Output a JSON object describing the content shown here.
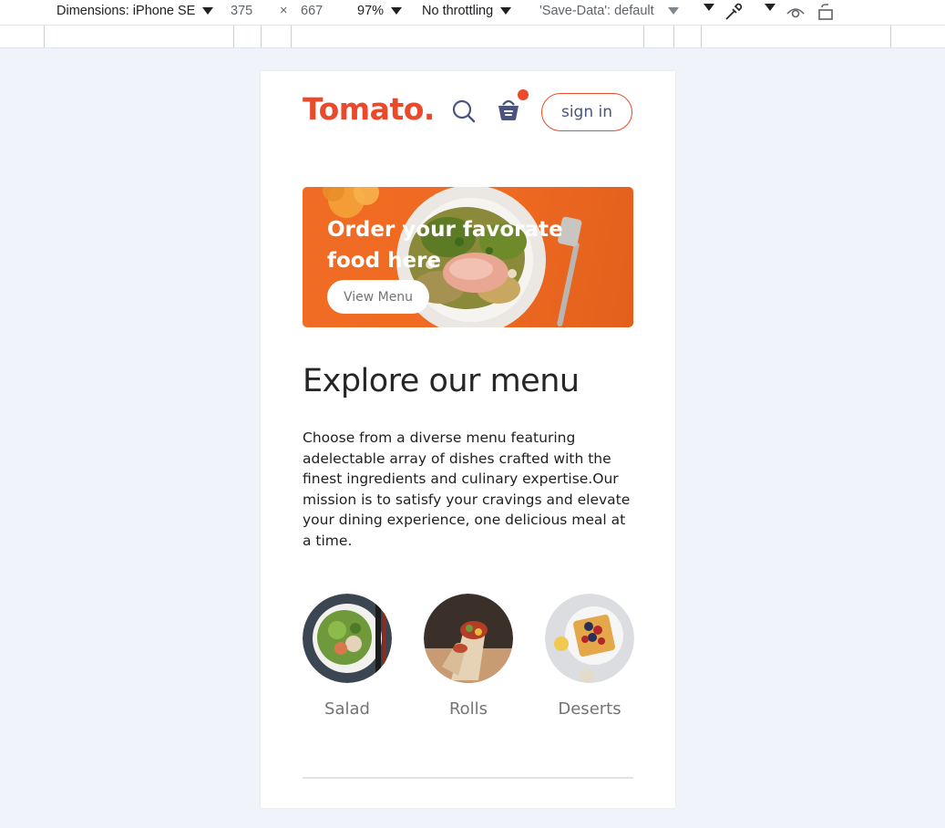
{
  "devtools": {
    "dimensions_label": "Dimensions: iPhone SE",
    "width": "375",
    "times": "×",
    "height": "667",
    "zoom": "97%",
    "throttling": "No throttling",
    "save_data": "'Save-Data': default"
  },
  "header": {
    "logo": "Tomato.",
    "signin_label": "sign in",
    "cart_has_items": true
  },
  "hero": {
    "title": "Order your favorate food here",
    "button_label": "View Menu"
  },
  "explore": {
    "title": "Explore our menu",
    "text": "Choose from a diverse menu featuring adelectable array of dishes crafted with the finest ingredients and culinary expertise.Our mission is to satisfy your cravings and elevate your dining experience, one delicious meal at a time."
  },
  "menu": {
    "items": [
      {
        "label": "Salad"
      },
      {
        "label": "Rolls"
      },
      {
        "label": "Deserts"
      }
    ]
  },
  "colors": {
    "brand": "#ea4a2b",
    "text_dark": "#262626",
    "muted": "#747474",
    "icon": "#49557e"
  }
}
